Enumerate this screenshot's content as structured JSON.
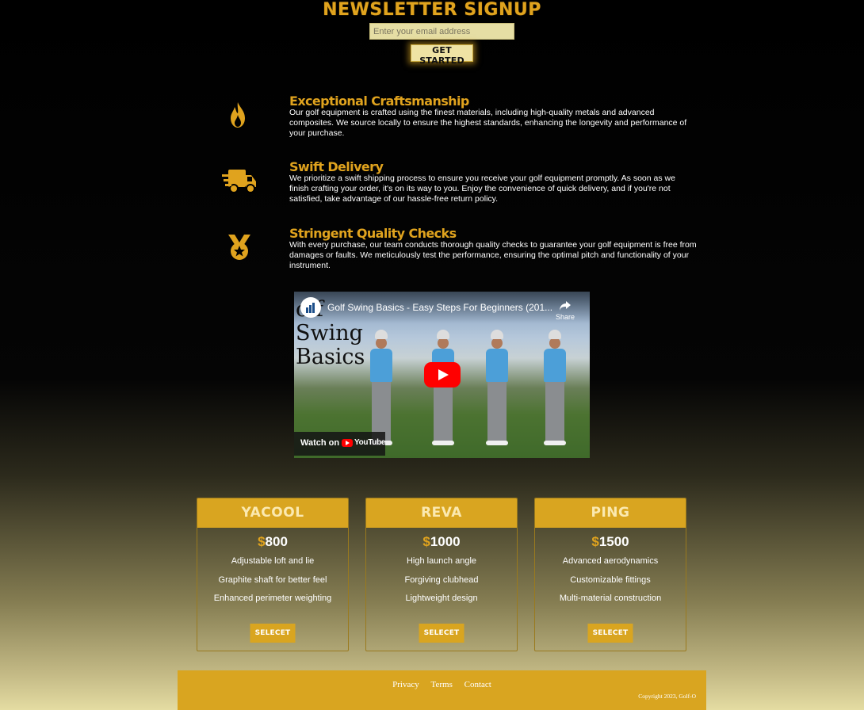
{
  "newsletter": {
    "title": "NEWSLETTER SIGNUP",
    "email_placeholder": "Enter your email address",
    "button_label": "GET STARTED"
  },
  "features": [
    {
      "icon": "flame-icon",
      "title": "Exceptional Craftsmanship",
      "text": "Our golf equipment is crafted using the finest materials, including high-quality metals and advanced composites. We source locally to ensure the highest standards, enhancing the longevity and performance of your purchase."
    },
    {
      "icon": "truck-icon",
      "title": "Swift Delivery",
      "text": "We prioritize a swift shipping process to ensure you receive your golf equipment promptly. As soon as we finish crafting your order, it's on its way to you. Enjoy the convenience of quick delivery, and if you're not satisfied, take advantage of our hassle-free return policy."
    },
    {
      "icon": "medal-icon",
      "title": "Stringent Quality Checks",
      "text": "With every purchase, our team conducts thorough quality checks to guarantee your golf equipment is free from damages or faults. We meticulously test the performance, ensuring the optimal pitch and functionality of your instrument."
    }
  ],
  "video": {
    "title": "Golf Swing Basics - Easy Steps For Beginners (201...",
    "thumbnail_text": "olf Swing Basics",
    "share_label": "Share",
    "watch_on": "Watch on",
    "platform": "YouTube"
  },
  "plans": [
    {
      "name": "YACOOL",
      "currency": "$",
      "price": "800",
      "features": [
        "Adjustable loft and lie",
        "Graphite shaft for better feel",
        "Enhanced perimeter weighting"
      ],
      "button": "SELECET"
    },
    {
      "name": "REVA",
      "currency": "$",
      "price": "1000",
      "features": [
        "High launch angle",
        "Forgiving clubhead",
        "Lightweight design"
      ],
      "button": "SELECET"
    },
    {
      "name": "PING",
      "currency": "$",
      "price": "1500",
      "features": [
        "Advanced aerodynamics",
        "Customizable fittings",
        "Multi-material construction"
      ],
      "button": "SELECET"
    }
  ],
  "footer": {
    "links": [
      "Privacy",
      "Terms",
      "Contact"
    ],
    "copyright": "Copyright 2023, Golf-O"
  },
  "colors": {
    "accent": "#d9a520",
    "heading_gold": "#e0a31e",
    "input_bg": "#e6dea4"
  }
}
